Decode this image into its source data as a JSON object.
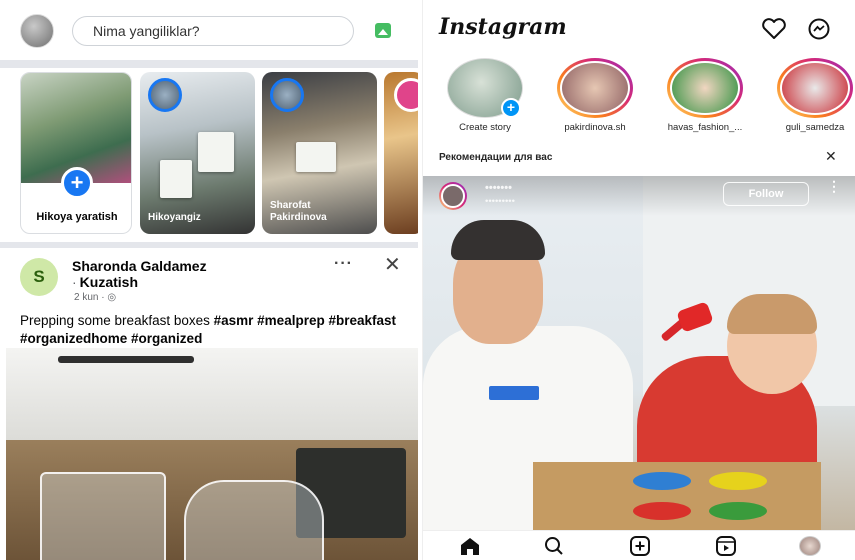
{
  "facebook": {
    "composer": {
      "placeholder": "Nima yangiliklar?"
    },
    "stories": [
      {
        "label": "Hikoya yaratish"
      },
      {
        "label": "Hikoyangiz"
      },
      {
        "label": "Sharofat Pakirdinova"
      }
    ],
    "post": {
      "avatar_letter": "S",
      "author": "Sharonda Galdamez",
      "group": "Kuzatish",
      "time": "2 kun",
      "text_plain": "Prepping some breakfast boxes ",
      "hashtags": [
        "#asmr",
        "#mealprep",
        "#breakfast",
        "#organizedhome",
        "#organized"
      ],
      "more": "···",
      "close": "✕"
    },
    "colors": {
      "accent": "#1877f2",
      "photo_icon": "#45bd62",
      "separator": "#e4e6eb"
    }
  },
  "instagram": {
    "logo": "Instagram",
    "stories": [
      {
        "name": "Create story"
      },
      {
        "name": "pakirdinova.sh"
      },
      {
        "name": "havas_fashion_..."
      },
      {
        "name": "guli_samedza"
      }
    ],
    "recommendations_label": "Рекомендации для вас",
    "recommendations_close": "✕",
    "reel": {
      "username": "•••••••",
      "subtitle": "•••••••••",
      "follow_label": "Follow",
      "more": "⋮"
    },
    "nav": [
      "home-icon",
      "search-icon",
      "create-icon",
      "reels-icon",
      "profile-icon"
    ],
    "colors": {
      "story_ring": "#d62976",
      "plus": "#0095f6"
    }
  }
}
